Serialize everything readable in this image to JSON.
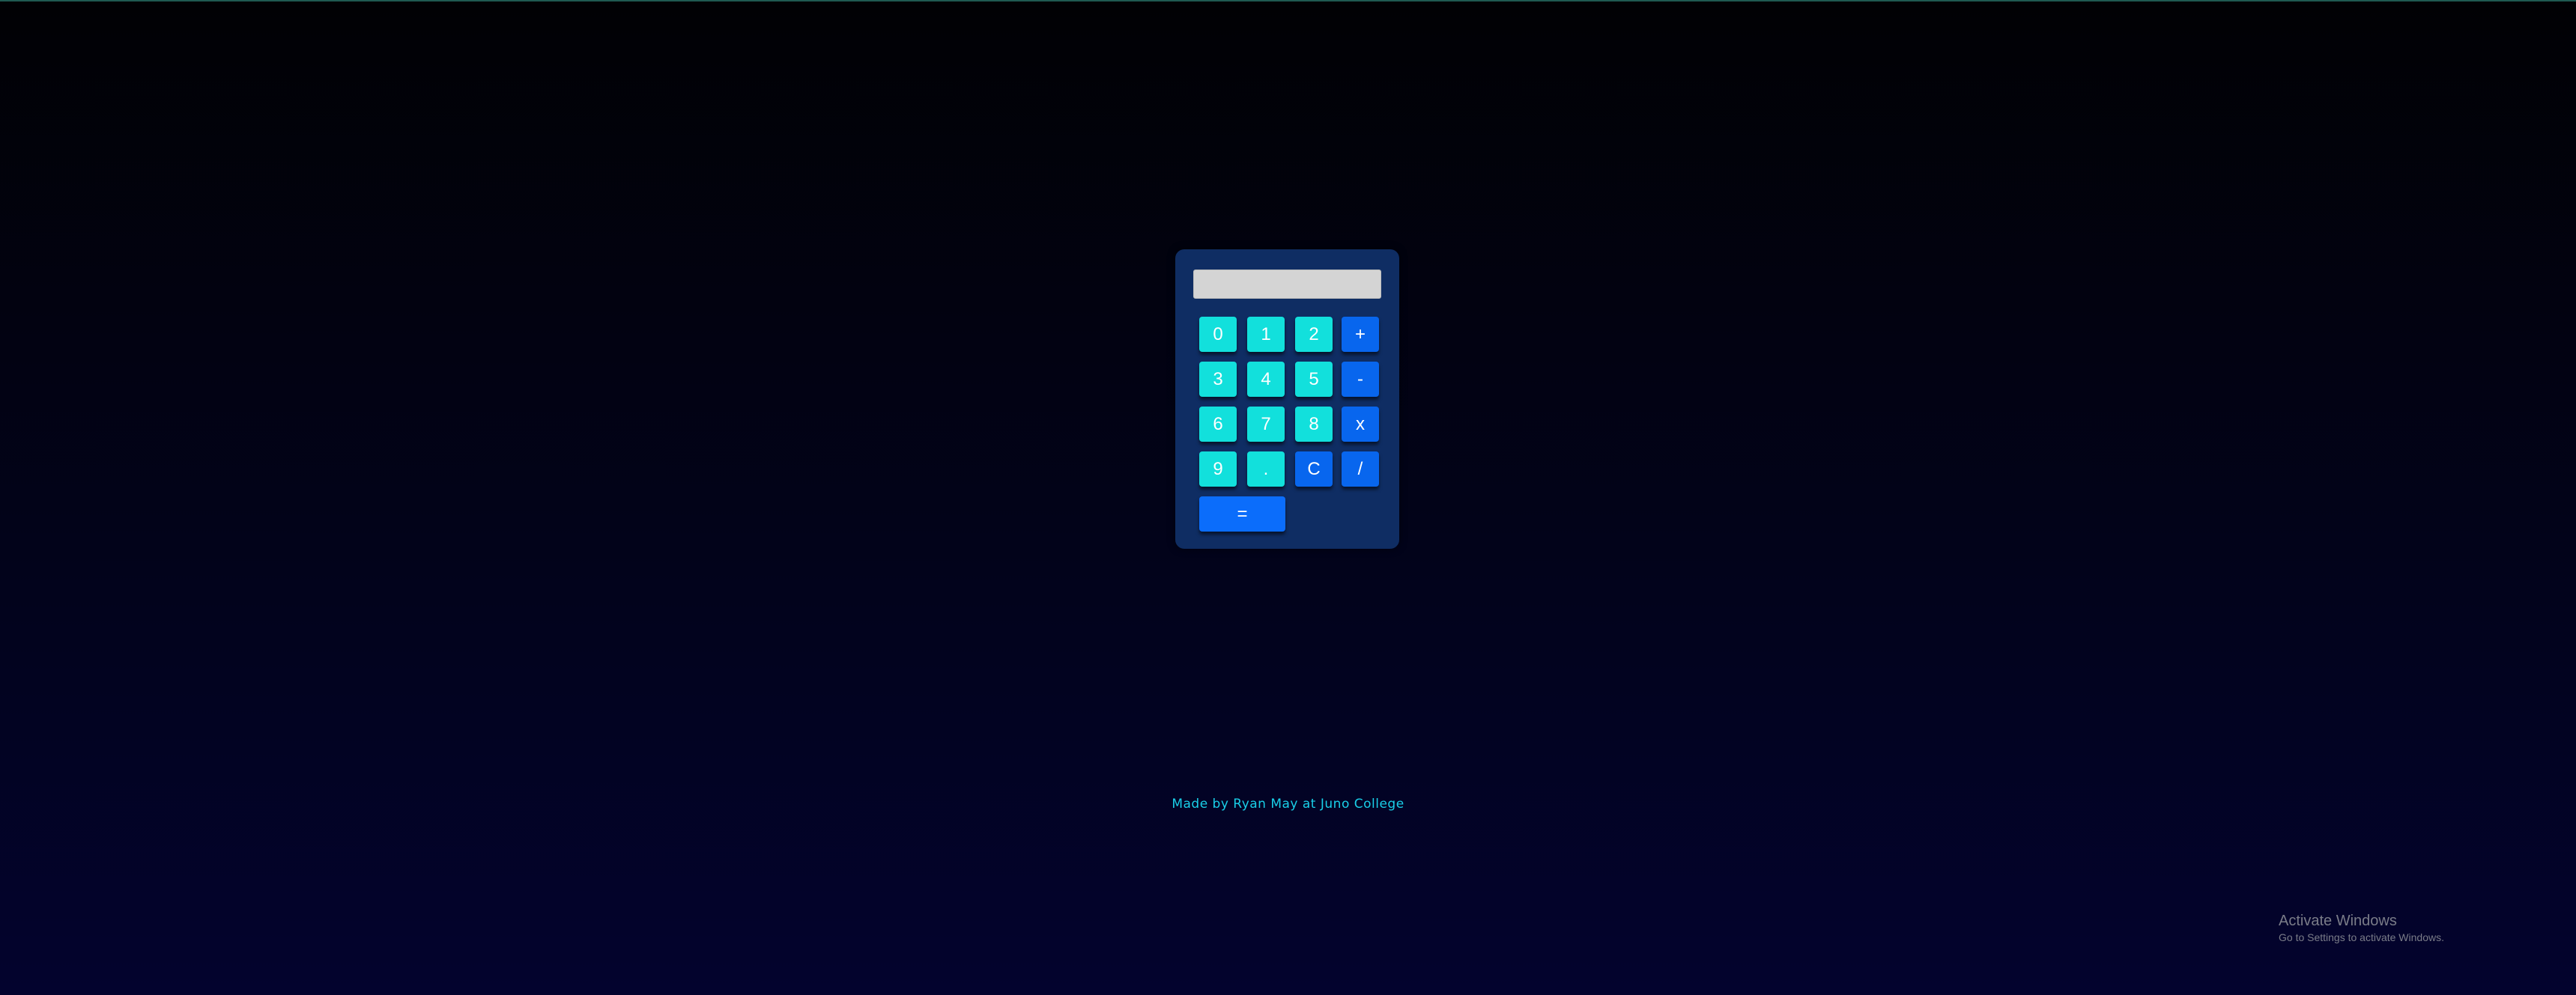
{
  "calculator": {
    "display_value": "",
    "keys": {
      "k0": "0",
      "k1": "1",
      "k2": "2",
      "plus": "+",
      "k3": "3",
      "k4": "4",
      "k5": "5",
      "minus": "-",
      "k6": "6",
      "k7": "7",
      "k8": "8",
      "times": "x",
      "k9": "9",
      "decimal": ".",
      "clear": "C",
      "divide": "/",
      "equals": "="
    }
  },
  "footer": {
    "credit": "Made by Ryan May at Juno College"
  },
  "watermark": {
    "title": "Activate Windows",
    "subtitle": "Go to Settings to activate Windows."
  },
  "colors": {
    "background_top": "#010104",
    "background_bottom": "#03032e",
    "calculator_body": "#0f2d63",
    "number_key": "#12e0dc",
    "operator_key": "#0866ee",
    "display": "#d4d4d4",
    "footer_text": "#19cfe8"
  }
}
